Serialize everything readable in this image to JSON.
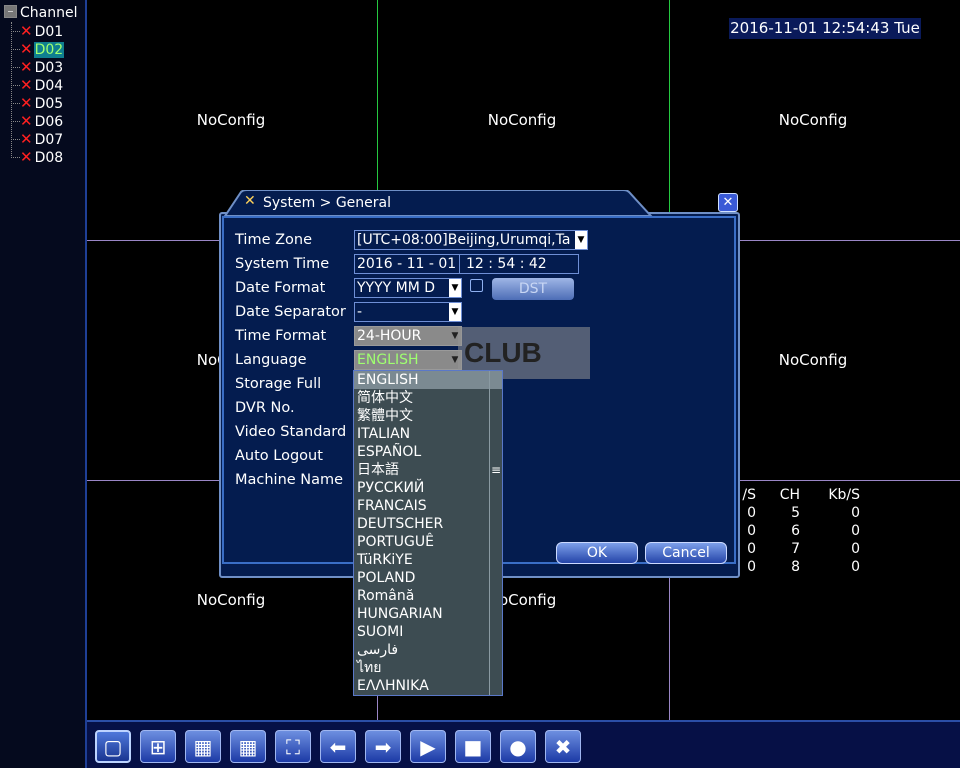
{
  "sidebar": {
    "title": "Channel",
    "channels": [
      {
        "label": "D01",
        "selected": false
      },
      {
        "label": "D02",
        "selected": true
      },
      {
        "label": "D03",
        "selected": false
      },
      {
        "label": "D04",
        "selected": false
      },
      {
        "label": "D05",
        "selected": false
      },
      {
        "label": "D06",
        "selected": false
      },
      {
        "label": "D07",
        "selected": false
      },
      {
        "label": "D08",
        "selected": false
      }
    ]
  },
  "grid": {
    "datetime": "2016-11-01 12:54:43 Tue",
    "cell_label": "NoConfig",
    "stats": {
      "headers": [
        "/S",
        "CH",
        "Kb/S"
      ],
      "rows": [
        [
          "0",
          "5",
          "0"
        ],
        [
          "0",
          "6",
          "0"
        ],
        [
          "0",
          "7",
          "0"
        ],
        [
          "0",
          "8",
          "0"
        ]
      ]
    }
  },
  "dialog": {
    "title": "System > General",
    "labels": {
      "time_zone": "Time Zone",
      "system_time": "System Time",
      "date_format": "Date Format",
      "date_separator": "Date Separator",
      "time_format": "Time Format",
      "language": "Language",
      "storage_full": "Storage Full",
      "dvr_no": "DVR No.",
      "video_standard": "Video Standard",
      "auto_logout": "Auto Logout",
      "machine_name": "Machine Name"
    },
    "values": {
      "time_zone": "[UTC+08:00]Beijing,Urumqi,Ta",
      "system_date": "2016 - 11 - 01",
      "system_clock": "12 : 54 : 42",
      "date_format": "YYYY MM D",
      "date_separator": "-",
      "time_format": "24-HOUR",
      "language": "ENGLISH"
    },
    "dst_label": "DST",
    "ok_label": "OK",
    "cancel_label": "Cancel"
  },
  "language_options": [
    "ENGLISH",
    "简体中文",
    "繁體中文",
    "ITALIAN",
    "ESPAÑOL",
    "日本語",
    "РУССКИЙ",
    "FRANCAIS",
    "DEUTSCHER",
    "PORTUGUÊ",
    "TüRKiYE",
    "POLAND",
    "Română",
    "HUNGARIAN",
    "SUOMI",
    "فارسی",
    "ไทย",
    "ΕΛΛΗΝΙΚΑ"
  ],
  "watermark": "CLUB",
  "toolbar": {
    "buttons": [
      {
        "icon": "single-view-icon",
        "glyph": "▢"
      },
      {
        "icon": "quad-view-icon",
        "glyph": "⊞"
      },
      {
        "icon": "multi-view-icon",
        "glyph": "▦"
      },
      {
        "icon": "nine-view-icon",
        "glyph": "▦"
      },
      {
        "icon": "fullscreen-icon",
        "glyph": "⛶"
      },
      {
        "icon": "previous-icon",
        "glyph": "⬅"
      },
      {
        "icon": "next-icon",
        "glyph": "➡"
      },
      {
        "icon": "playback-icon",
        "glyph": "▶"
      },
      {
        "icon": "stop-playback-icon",
        "glyph": "■"
      },
      {
        "icon": "record-icon",
        "glyph": "●"
      },
      {
        "icon": "stop-record-icon",
        "glyph": "✖"
      }
    ]
  },
  "colors": {
    "selected_text": "#9fff70",
    "grid_line": "#9a86c6",
    "active_line": "#25c840",
    "error_x": "#ff2020"
  }
}
